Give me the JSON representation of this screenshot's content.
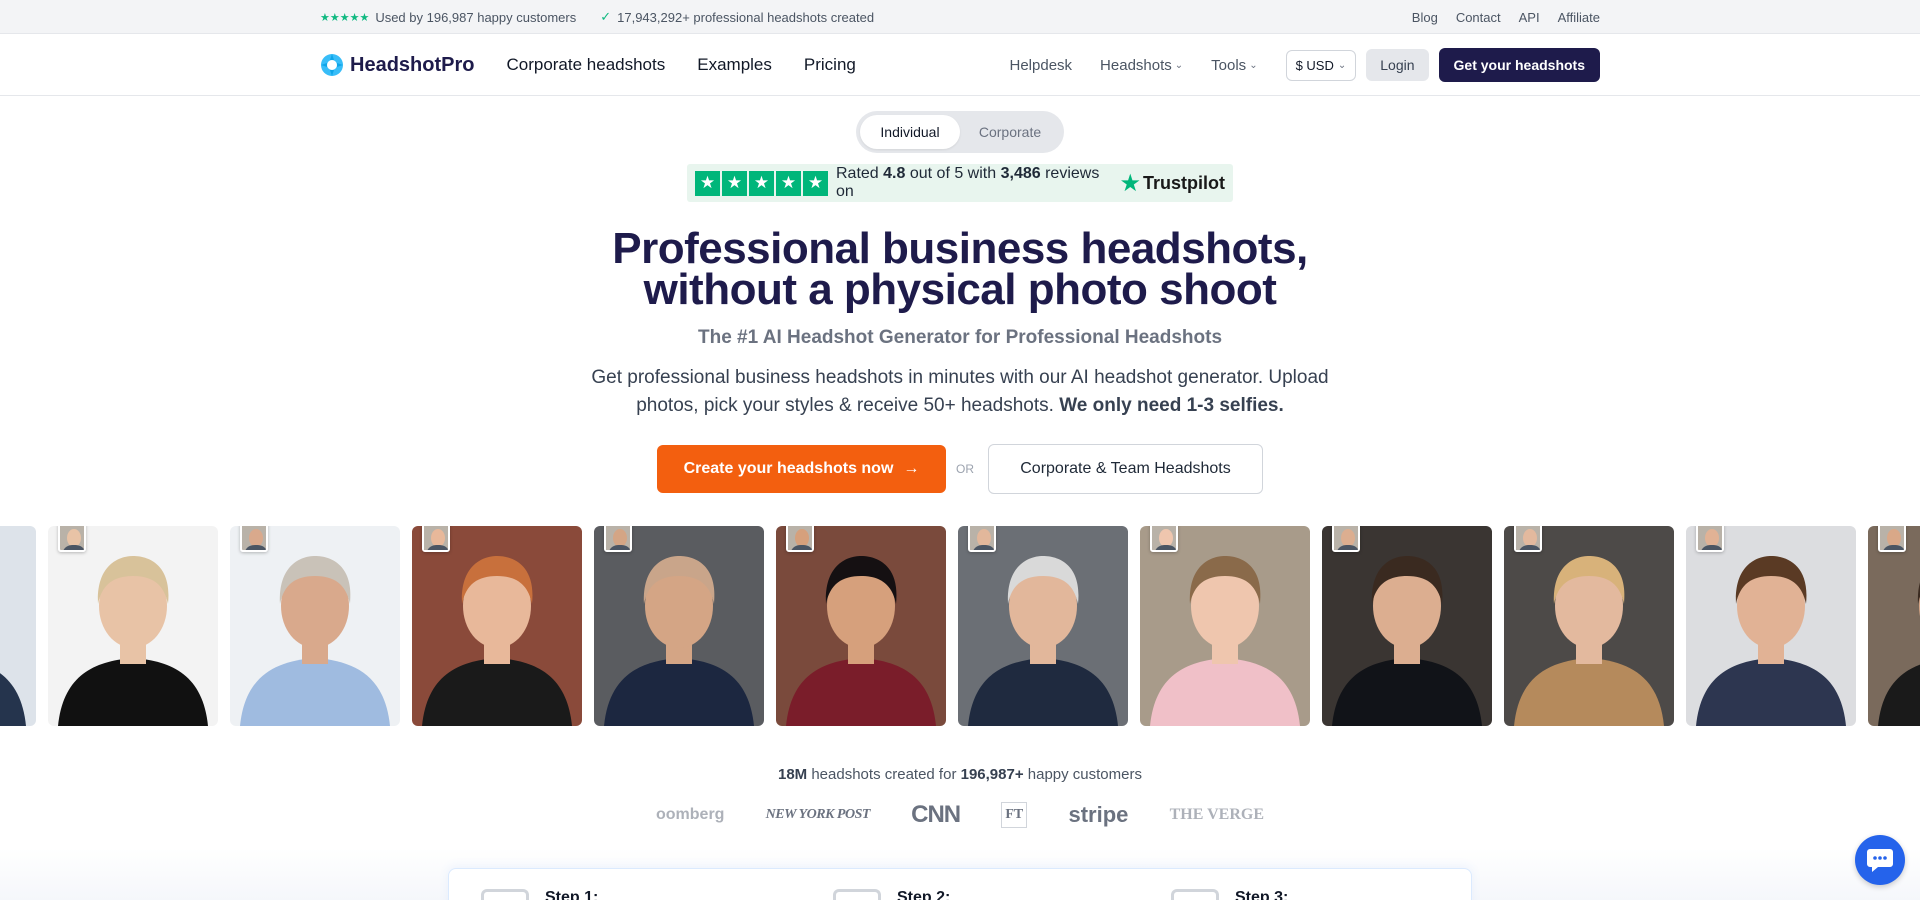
{
  "topbar": {
    "rating_stars": "★★★★★",
    "customers": "Used by 196,987 happy customers",
    "check": "✓",
    "headshots": "17,943,292+ professional headshots created",
    "links": [
      "Blog",
      "Contact",
      "API",
      "Affiliate"
    ]
  },
  "header": {
    "logo": "HeadshotPro",
    "main_nav": [
      "Corporate headshots",
      "Examples",
      "Pricing"
    ],
    "helpdesk": "Helpdesk",
    "headshots_menu": "Headshots",
    "tools_menu": "Tools",
    "currency": "$ USD",
    "login": "Login",
    "cta": "Get your headshots"
  },
  "toggle": {
    "individual": "Individual",
    "corporate": "Corporate"
  },
  "trust": {
    "rated": "Rated",
    "score": "4.8",
    "out_of": "out of 5 with",
    "reviews": "3,486",
    "reviews_on": "reviews on",
    "brand": "Trustpilot"
  },
  "hero": {
    "title_line1": "Professional business headshots,",
    "title_line2": "without a physical photo shoot",
    "subtitle": "The #1 AI Headshot Generator for Professional Headshots",
    "desc_main": "Get professional business headshots in minutes with our AI headshot generator. Upload photos, pick your styles & receive 50+ headshots.",
    "desc_bold": "We only need 1-3 selfies.",
    "primary_cta": "Create your headshots now",
    "arrow": "→",
    "or": "OR",
    "secondary_cta": "Corporate & Team Headshots"
  },
  "social": {
    "count": "18M",
    "mid": "headshots created for",
    "customers": "196,987+",
    "tail": "happy customers"
  },
  "press": [
    "oomberg",
    "NEW YORK POST",
    "CNN",
    "FT",
    "stripe",
    "THE VERGE"
  ],
  "steps": [
    "Step 1:",
    "Step 2:",
    "Step 3:"
  ],
  "colors": {
    "brand": "#1e1b4b",
    "accent": "#f35f0f",
    "trustpilot": "#00b67a"
  },
  "icons": {
    "chat": "chat-bubble-icon",
    "logo": "aperture-logo-icon"
  }
}
